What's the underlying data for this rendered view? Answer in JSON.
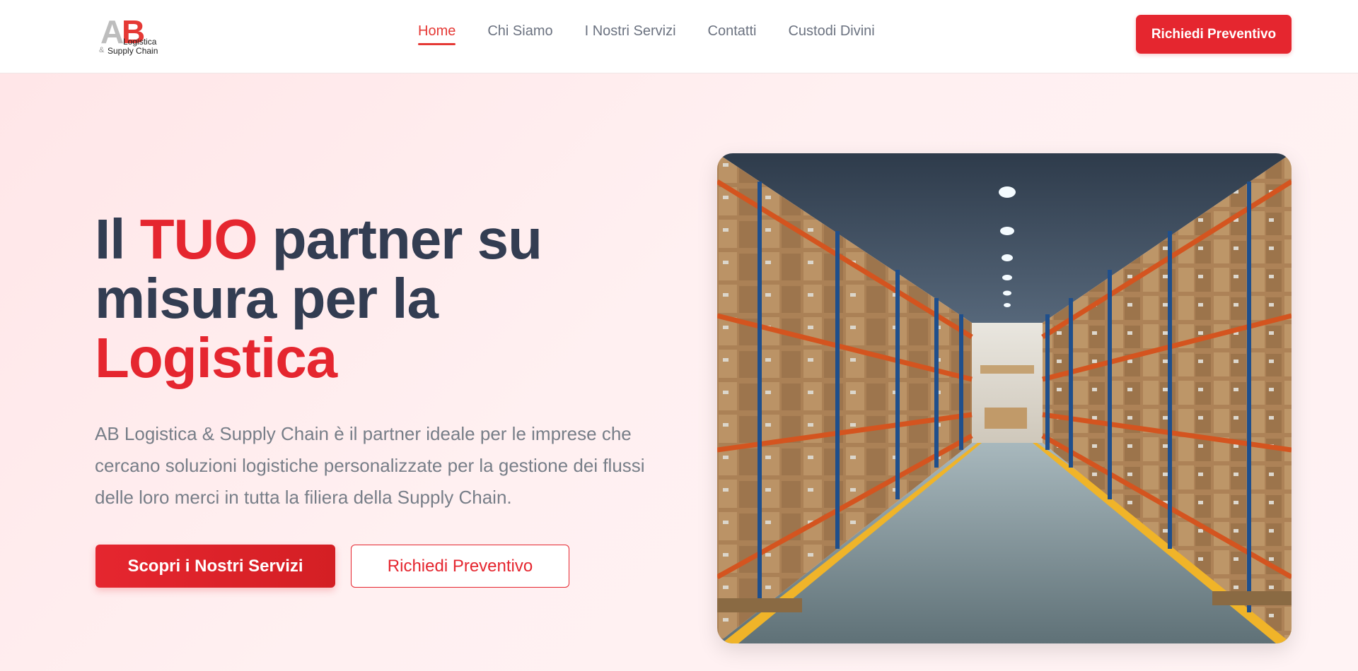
{
  "brand": {
    "logo_letter_a": "A",
    "logo_letter_b": "B",
    "logo_line1": "Logistica",
    "logo_amp": "&",
    "logo_line2": "Supply Chain"
  },
  "nav": {
    "items": [
      {
        "label": "Home",
        "active": true
      },
      {
        "label": "Chi Siamo",
        "active": false
      },
      {
        "label": "I Nostri Servizi",
        "active": false
      },
      {
        "label": "Contatti",
        "active": false
      },
      {
        "label": "Custodi Divini",
        "active": false
      }
    ],
    "cta_label": "Richiedi Preventivo"
  },
  "hero": {
    "headline_part1": "Il ",
    "headline_highlight1": "TUO",
    "headline_part2": " partner su misura per la ",
    "headline_highlight2": "Logistica",
    "description": "AB Logistica & Supply Chain è il partner ideale per le imprese che cercano soluzioni logistiche personalizzate per la gestione dei flussi delle loro merci in tutta la filiera della Supply Chain.",
    "primary_button": "Scopri i Nostri Servizi",
    "secondary_button": "Richiedi Preventivo",
    "image_icon": "warehouse-aisle-photo"
  },
  "colors": {
    "accent": "#e5262f",
    "heading": "#333d52",
    "body_text": "#777e88",
    "hero_bg": "#ffe9eb"
  }
}
